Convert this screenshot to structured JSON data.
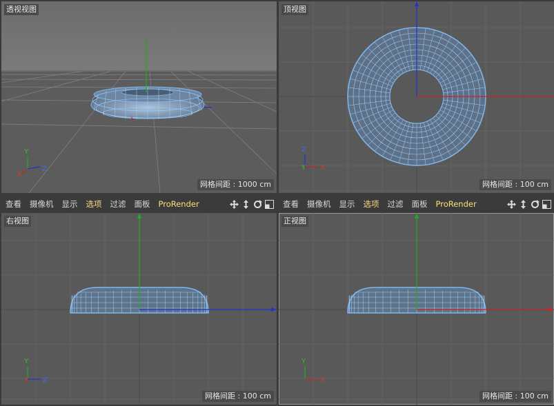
{
  "viewports": {
    "perspective": {
      "label": "透视视图",
      "grid_spacing": "网格间距 : 1000 cm"
    },
    "top": {
      "label": "顶视图",
      "grid_spacing": "网格间距 : 100 cm"
    },
    "right": {
      "label": "右视图",
      "grid_spacing": "网格间距 : 100 cm"
    },
    "front": {
      "label": "正视图",
      "grid_spacing": "网格间距 : 100 cm"
    }
  },
  "menu": {
    "items": [
      "查看",
      "摄像机",
      "显示",
      "选项",
      "过滤",
      "面板",
      "ProRender"
    ],
    "highlighted": "选项"
  },
  "axis_labels": {
    "x": "X",
    "y": "Y",
    "z": "Z"
  },
  "colors": {
    "viewport_bg": "#595959",
    "grid": "#6a6a6a",
    "mesh": "#7fb8ee",
    "x_axis": "#cc2222",
    "y_axis": "#22aa22",
    "z_axis": "#2233cc"
  },
  "icons": [
    "move-view-icon",
    "zoom-view-icon",
    "rotate-view-icon",
    "toggle-layout-icon"
  ]
}
